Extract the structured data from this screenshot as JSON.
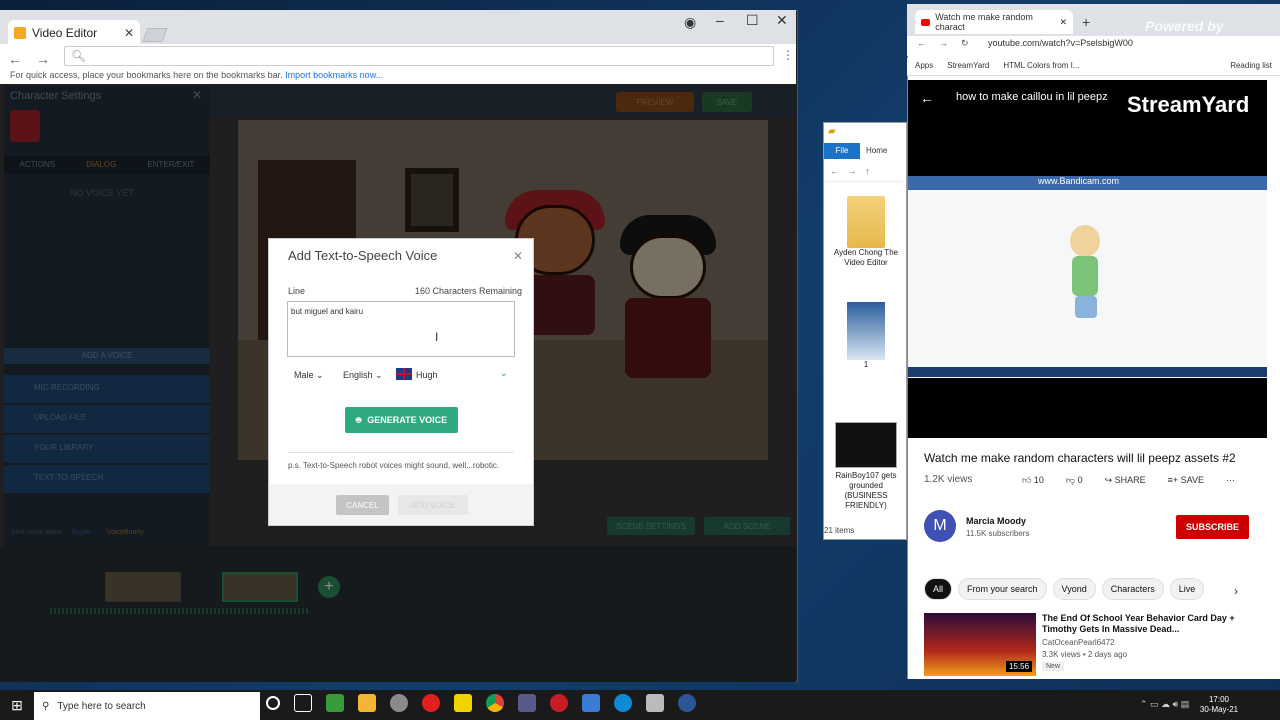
{
  "left_browser": {
    "tab_title": "Video Editor",
    "bookmarks_hint": "For quick access, place your bookmarks here on the bookmarks bar.",
    "bookmarks_link": "Import bookmarks now..."
  },
  "editor": {
    "panel_title": "Character Settings",
    "tabs": [
      "ACTIONS",
      "DIALOG",
      "ENTER/EXIT"
    ],
    "no_voice": "NO VOICE YET",
    "add_voice_header": "ADD A VOICE",
    "voice_options": [
      "MIC RECORDING",
      "UPLOAD FILE",
      "YOUR LIBRARY",
      "TEXT-TO-SPEECH"
    ],
    "hire_text": "Hire voice talent",
    "voice_brands": [
      "buyvo",
      "VoiceBunny"
    ],
    "preview_label": "PREVIEW",
    "save_label": "SAVE",
    "scene_settings_label": "SCENE SETTINGS",
    "add_scene_label": "ADD SCENE"
  },
  "dialog": {
    "title": "Add Text-to-Speech Voice",
    "line_label": "Line",
    "remaining": "160 Characters Remaining",
    "line_text": "but miguel and kairu",
    "gender": "Male",
    "language": "English",
    "voice": "Hugh",
    "generate_label": "GENERATE VOICE",
    "note": "p.s. Text-to-Speech robot voices might sound, well...robotic.",
    "cancel_label": "CANCEL",
    "add_voice_label": "ADD VOICE"
  },
  "explorer": {
    "file_tab": "File",
    "home_tab": "Home",
    "items": [
      {
        "label": "Ayden Chong The Video Editor"
      },
      {
        "label": "1"
      },
      {
        "label": "RainBoy107 gets grounded (BUSINESS FRIENDLY)"
      }
    ],
    "item_count": "21 items"
  },
  "youtube": {
    "tab_title": "Watch me make random charact",
    "url": "youtube.com/watch?v=PselsbigW00",
    "bookmarks": [
      "Apps",
      "StreamYard",
      "HTML Colors from I...",
      "Reading list"
    ],
    "powered_by": "Powered by",
    "player_title": "how to make caillou in lil peepz",
    "streamyard_brand": "StreamYard",
    "bandicam_watermark": "www.Bandicam.com",
    "video_title": "Watch me make random characters will lil peepz assets #2",
    "views": "1.2K views",
    "likes": "10",
    "dislikes": "0",
    "share_label": "SHARE",
    "save_label": "SAVE",
    "channel_avatar_letter": "M",
    "channel_name": "Marcia Moody",
    "subscribers": "11.5K subscribers",
    "subscribe_label": "SUBSCRIBE",
    "chips": [
      "All",
      "From your search",
      "Vyond",
      "Characters",
      "Live"
    ],
    "recommendation": {
      "title": "The End Of School Year Behavior Card Day + Timothy Gets In Massive Dead...",
      "channel": "CatOceanPearl6472",
      "meta": "3.3K views • 2 days ago",
      "badge": "New",
      "duration": "15:56"
    }
  },
  "taskbar": {
    "search_placeholder": "Type here to search",
    "time": "17:00",
    "date": "30-May-21"
  }
}
